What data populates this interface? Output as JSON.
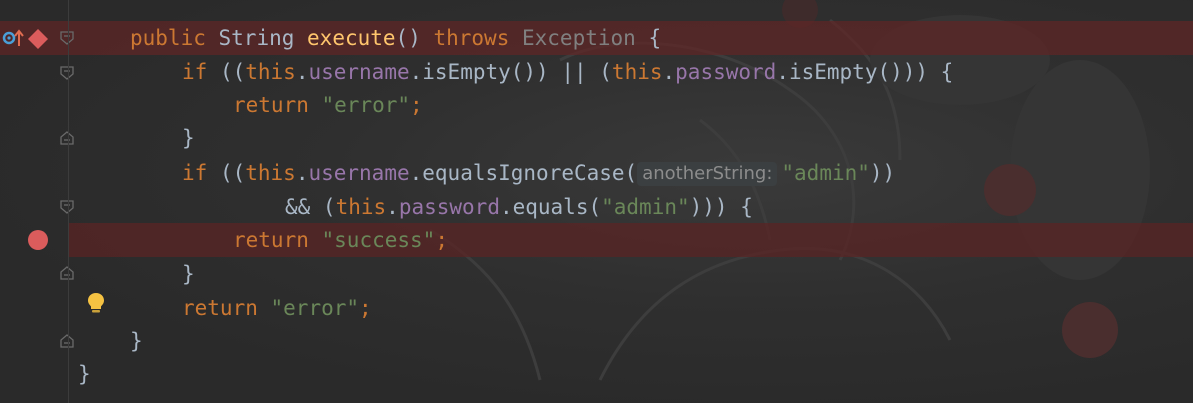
{
  "editor": {
    "colors": {
      "background": "#2b2b2b",
      "keyword": "#cc7832",
      "method_name": "#ffc66d",
      "field": "#9876aa",
      "string": "#6a8759",
      "text": "#a9b7c6",
      "exception_type": "#808080",
      "breakpoint": "#db5c5c",
      "line_highlight": "#5a2424"
    },
    "gutter": {
      "icons": [
        "override-indicator-icon",
        "exception-breakpoint-icon",
        "breakpoint-icon",
        "lightbulb-icon",
        "fold-icon"
      ]
    },
    "lines": [
      {
        "tokens": [
          {
            "t": "public ",
            "c": "kw"
          },
          {
            "t": "String ",
            "c": "typ"
          },
          {
            "t": "execute",
            "c": "fn"
          },
          {
            "t": "() ",
            "c": "typ"
          },
          {
            "t": "throws ",
            "c": "kw"
          },
          {
            "t": "Exception",
            "c": "exc"
          },
          {
            "t": " {",
            "c": "typ"
          }
        ]
      },
      {
        "tokens": [
          {
            "t": "if ",
            "c": "kw"
          },
          {
            "t": "((",
            "c": "typ"
          },
          {
            "t": "this",
            "c": "kw"
          },
          {
            "t": ".",
            "c": "typ"
          },
          {
            "t": "username",
            "c": "fld"
          },
          {
            "t": ".isEmpty()) || (",
            "c": "typ"
          },
          {
            "t": "this",
            "c": "kw"
          },
          {
            "t": ".",
            "c": "typ"
          },
          {
            "t": "password",
            "c": "fld"
          },
          {
            "t": ".isEmpty())) {",
            "c": "typ"
          }
        ]
      },
      {
        "tokens": [
          {
            "t": "return ",
            "c": "kw"
          },
          {
            "t": "\"error\"",
            "c": "str"
          },
          {
            "t": ";",
            "c": "kw"
          }
        ]
      },
      {
        "tokens": [
          {
            "t": "}",
            "c": "typ"
          }
        ]
      },
      {
        "tokens": [
          {
            "t": "if ",
            "c": "kw"
          },
          {
            "t": "((",
            "c": "typ"
          },
          {
            "t": "this",
            "c": "kw"
          },
          {
            "t": ".",
            "c": "typ"
          },
          {
            "t": "username",
            "c": "fld"
          },
          {
            "t": ".equalsIgnoreCase(",
            "c": "typ"
          },
          {
            "t": "anotherString:",
            "c": "hint"
          },
          {
            "t": "\"admin\"",
            "c": "str"
          },
          {
            "t": "))",
            "c": "typ"
          }
        ]
      },
      {
        "tokens": [
          {
            "t": "&& (",
            "c": "typ"
          },
          {
            "t": "this",
            "c": "kw"
          },
          {
            "t": ".",
            "c": "typ"
          },
          {
            "t": "password",
            "c": "fld"
          },
          {
            "t": ".equals(",
            "c": "typ"
          },
          {
            "t": "\"admin\"",
            "c": "str"
          },
          {
            "t": "))) {",
            "c": "typ"
          }
        ]
      },
      {
        "tokens": [
          {
            "t": "return ",
            "c": "kw"
          },
          {
            "t": "\"success\"",
            "c": "str"
          },
          {
            "t": ";",
            "c": "kw"
          }
        ]
      },
      {
        "tokens": [
          {
            "t": "}",
            "c": "typ"
          }
        ]
      },
      {
        "tokens": [
          {
            "t": "return ",
            "c": "kw"
          },
          {
            "t": "\"error\"",
            "c": "str"
          },
          {
            "t": ";",
            "c": "kw"
          }
        ]
      },
      {
        "tokens": [
          {
            "t": "}",
            "c": "typ"
          }
        ]
      },
      {
        "tokens": [
          {
            "t": "}",
            "c": "typ"
          }
        ]
      }
    ]
  }
}
